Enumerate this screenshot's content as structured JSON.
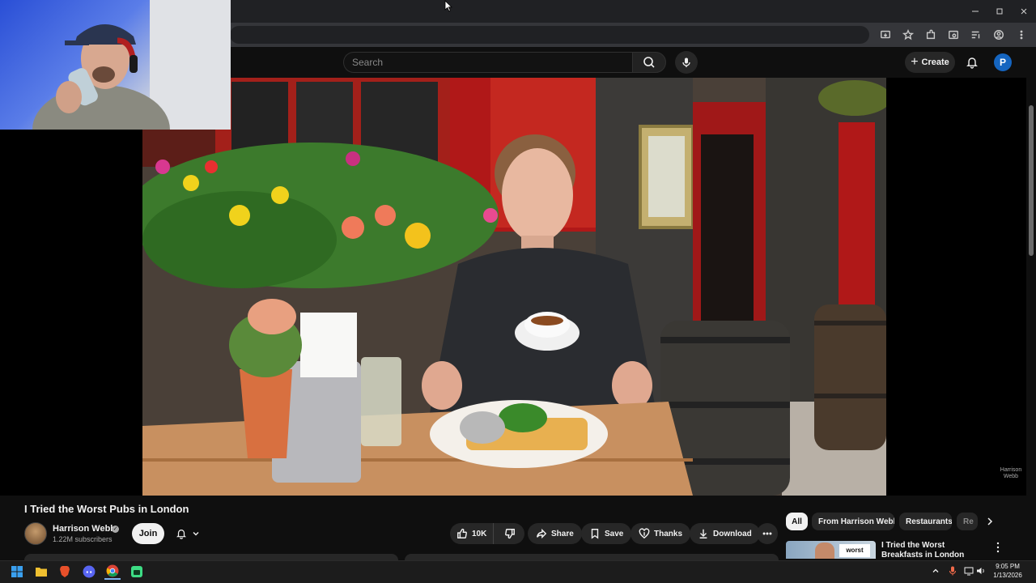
{
  "browser": {
    "window_controls": [
      "minimize",
      "restore",
      "close"
    ]
  },
  "masthead": {
    "search_placeholder": "Search",
    "create_label": "Create",
    "avatar_letter": "P"
  },
  "video": {
    "title": "I Tried the Worst Pubs in London",
    "watermark_line1": "Harrison",
    "watermark_line2": "Webb"
  },
  "channel": {
    "name": "Harrison Webb",
    "verified_mark": "✓",
    "subscribers": "1.22M subscribers",
    "join_label": "Join"
  },
  "actions": {
    "likes": "10K",
    "share": "Share",
    "save": "Save",
    "thanks": "Thanks",
    "download": "Download"
  },
  "chips": [
    "All",
    "From Harrison Webb",
    "Restaurants",
    "Re"
  ],
  "recommendation": {
    "title": "I Tried the Worst Breakfasts in London",
    "thumb_text": "worst"
  },
  "taskbar": {
    "time": "9:05 PM",
    "date": "1/13/2026"
  },
  "colors": {
    "background": "#0f0f0f",
    "pill": "#272727",
    "avatar": "#1565c0",
    "pub_red": "#b01818"
  }
}
